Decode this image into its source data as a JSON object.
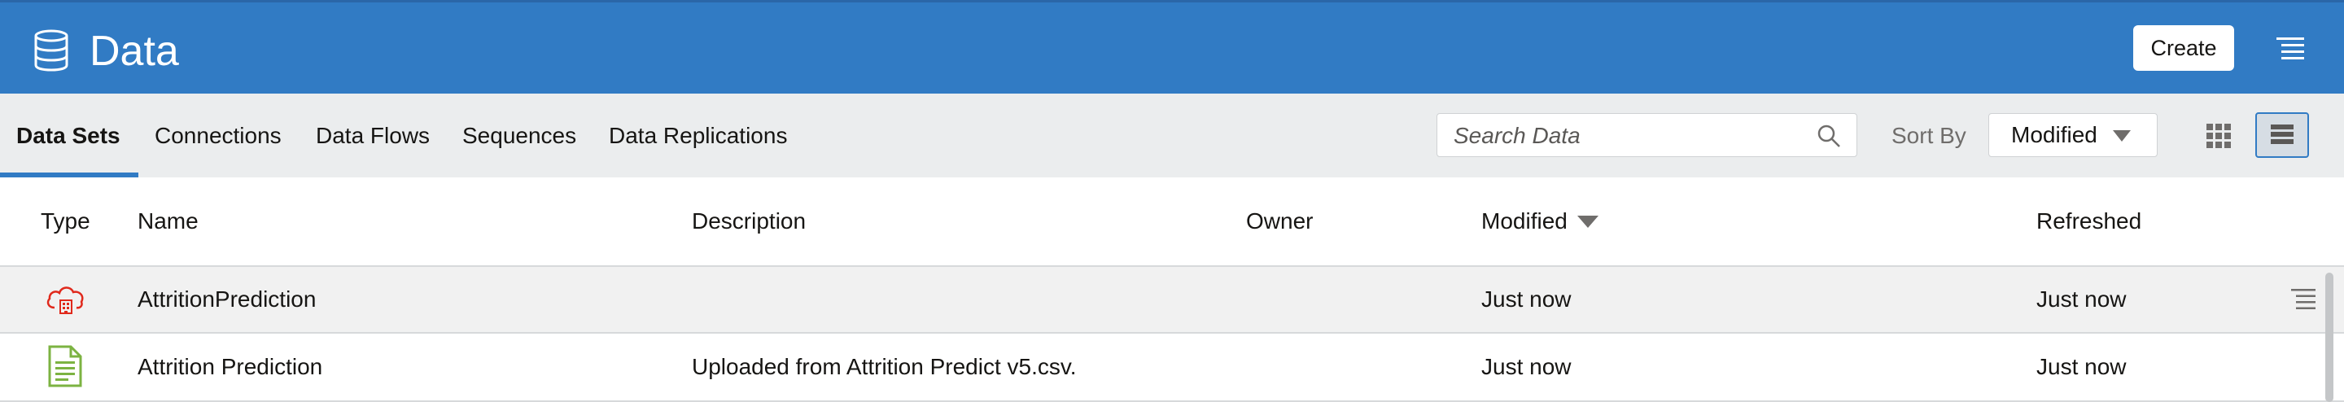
{
  "header": {
    "title": "Data",
    "create_label": "Create",
    "icon": "database-icon",
    "menu_icon": "hamburger-menu-icon",
    "accent_color": "#317bc4"
  },
  "tabs": [
    {
      "label": "Data Sets",
      "active": true
    },
    {
      "label": "Connections",
      "active": false
    },
    {
      "label": "Data Flows",
      "active": false
    },
    {
      "label": "Sequences",
      "active": false
    },
    {
      "label": "Data Replications",
      "active": false
    }
  ],
  "search": {
    "placeholder": "Search Data",
    "value": "",
    "icon": "search-icon"
  },
  "sort": {
    "label": "Sort By",
    "value": "Modified"
  },
  "view_toggle": {
    "grid_icon": "grid-view-icon",
    "list_icon": "list-view-icon",
    "selected": "list"
  },
  "table": {
    "columns": [
      "Type",
      "Name",
      "Description",
      "Owner",
      "Modified",
      "Refreshed"
    ],
    "sorted_column": "Modified",
    "rows": [
      {
        "type_icon": "cloud-dataset-icon",
        "name": "AttritionPrediction",
        "description": "",
        "owner": "",
        "modified": "Just now",
        "refreshed": "Just now"
      },
      {
        "type_icon": "file-dataset-icon",
        "name": "Attrition Prediction",
        "description": "Uploaded from Attrition Predict v5.csv.",
        "owner": "",
        "modified": "Just now",
        "refreshed": "Just now"
      }
    ]
  }
}
